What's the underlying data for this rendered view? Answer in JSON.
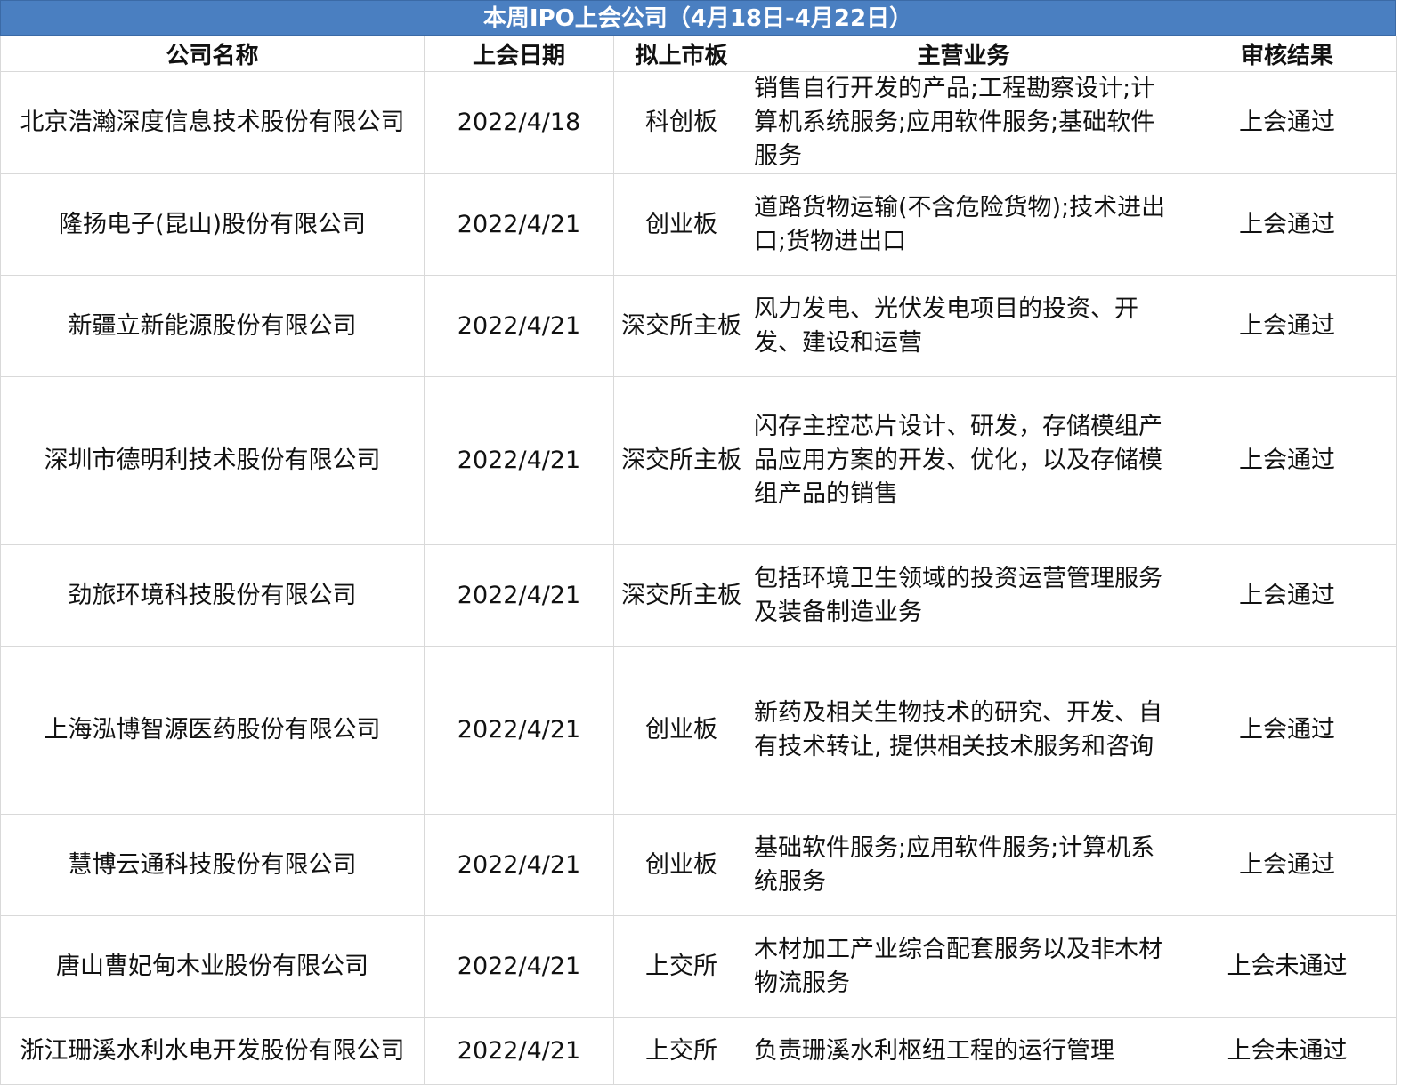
{
  "title": "本周IPO上会公司（4月18日-4月22日）",
  "headers": [
    "公司名称",
    "上会日期",
    "拟上市板",
    "主营业务",
    "审核结果"
  ],
  "rows": [
    {
      "company": "北京浩瀚深度信息技术股份有限公司",
      "date": "2022/4/18",
      "board": "科创板",
      "business": "销售自行开发的产品;工程勘察设计;计算机系统服务;应用软件服务;基础软件服务",
      "result": "上会通过"
    },
    {
      "company": "隆扬电子(昆山)股份有限公司",
      "date": "2022/4/21",
      "board": "创业板",
      "business": "道路货物运输(不含危险货物);技术进出口;货物进出口",
      "result": "上会通过"
    },
    {
      "company": "新疆立新能源股份有限公司",
      "date": "2022/4/21",
      "board": "深交所主板",
      "business": "风力发电、光伏发电项目的投资、开发、建设和运营",
      "result": "上会通过"
    },
    {
      "company": "深圳市德明利技术股份有限公司",
      "date": "2022/4/21",
      "board": "深交所主板",
      "business": "闪存主控芯片设计、研发，存储模组产品应用方案的开发、优化，以及存储模组产品的销售",
      "result": "上会通过"
    },
    {
      "company": "劲旅环境科技股份有限公司",
      "date": "2022/4/21",
      "board": "深交所主板",
      "business": "包括环境卫生领域的投资运营管理服务及装备制造业务",
      "result": "上会通过"
    },
    {
      "company": "上海泓博智源医药股份有限公司",
      "date": "2022/4/21",
      "board": "创业板",
      "business": "新药及相关生物技术的研究、开发、自有技术转让, 提供相关技术服务和咨询",
      "result": "上会通过"
    },
    {
      "company": "慧博云通科技股份有限公司",
      "date": "2022/4/21",
      "board": "创业板",
      "business": "基础软件服务;应用软件服务;计算机系统服务",
      "result": "上会通过"
    },
    {
      "company": "唐山曹妃甸木业股份有限公司",
      "date": "2022/4/21",
      "board": "上交所",
      "business": "木材加工产业综合配套服务以及非木材物流服务",
      "result": "上会未通过"
    },
    {
      "company": "浙江珊溪水利水电开发股份有限公司",
      "date": "2022/4/21",
      "board": "上交所",
      "business": "负责珊溪水利枢纽工程的运行管理",
      "result": "上会未通过"
    }
  ]
}
